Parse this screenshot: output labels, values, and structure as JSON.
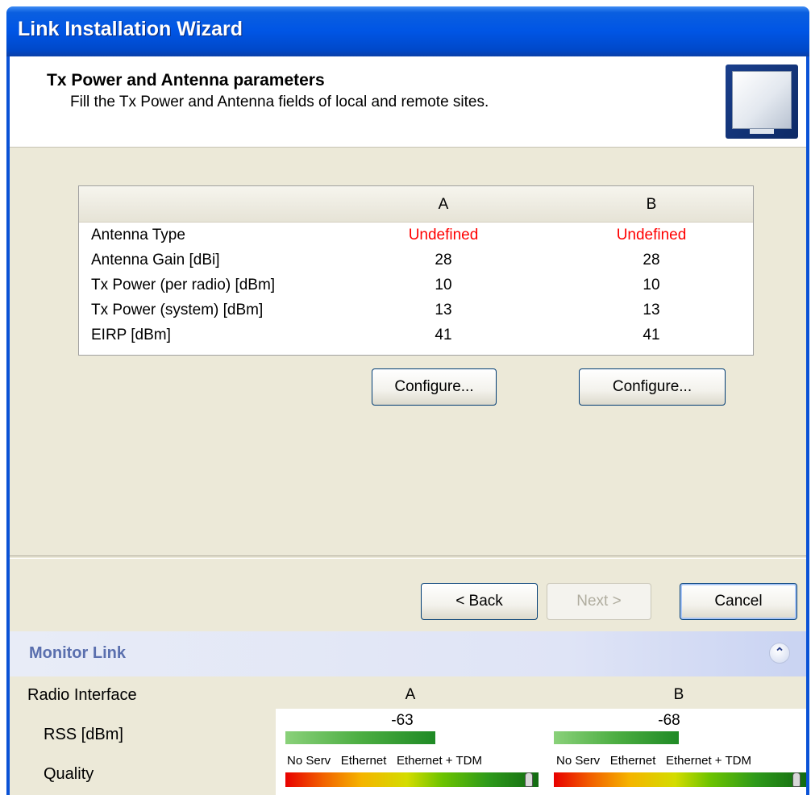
{
  "window": {
    "title": "Link Installation Wizard"
  },
  "header": {
    "title": "Tx Power and Antenna parameters",
    "subtitle": "Fill the Tx Power and Antenna fields of local and remote sites."
  },
  "table": {
    "columns": [
      "A",
      "B"
    ],
    "rows": [
      {
        "label": "Antenna Type",
        "a": "Undefined",
        "b": "Undefined"
      },
      {
        "label": "Antenna Gain [dBi]",
        "a": "28",
        "b": "28"
      },
      {
        "label": "Tx Power (per radio) [dBm]",
        "a": "10",
        "b": "10"
      },
      {
        "label": "Tx Power (system) [dBm]",
        "a": "13",
        "b": "13"
      },
      {
        "label": "EIRP [dBm]",
        "a": "41",
        "b": "41"
      }
    ],
    "undefined_color": "#ff0000"
  },
  "buttons": {
    "configure_a": "Configure...",
    "configure_b": "Configure...",
    "back": "< Back",
    "next": "Next >",
    "cancel": "Cancel"
  },
  "monitor": {
    "title": "Monitor Link",
    "collapse_icon": "double-chevron-up-icon",
    "radio_interface_label": "Radio Interface",
    "col_a": "A",
    "col_b": "B",
    "rss_label": "RSS [dBm]",
    "quality_label": "Quality",
    "rss_a": "-63",
    "rss_b": "-68",
    "quality_scale": {
      "no_serv": "No Serv",
      "ethernet": "Ethernet",
      "ethernet_tdm": "Ethernet + TDM"
    },
    "quality_a_fraction": 0.97,
    "quality_b_fraction": 0.97
  }
}
